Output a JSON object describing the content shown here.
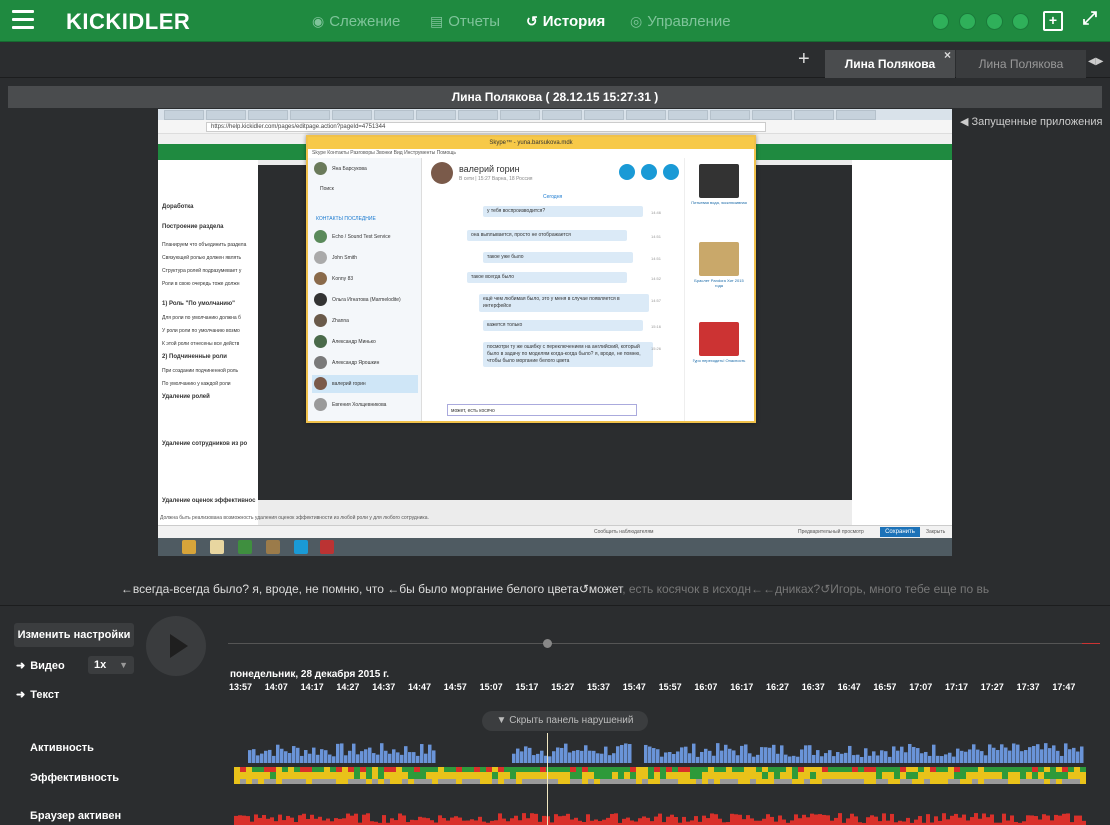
{
  "topbar": {
    "logo": "KICKIDLER",
    "nav": [
      {
        "label": "Слежение",
        "icon": "eye-icon",
        "glyph": "◉",
        "active": false
      },
      {
        "label": "Отчеты",
        "icon": "report-icon",
        "glyph": "▤",
        "active": false
      },
      {
        "label": "История",
        "icon": "history-icon",
        "glyph": "↺",
        "active": true
      },
      {
        "label": "Управление",
        "icon": "manage-icon",
        "glyph": "◎",
        "active": false
      }
    ],
    "colors": {
      "green": "#1f8a40",
      "active_dot": "#2fb05a"
    }
  },
  "tabs": {
    "items": [
      {
        "label": "Лина Полякова",
        "active": true
      },
      {
        "label": "Лина Полякова",
        "active": false
      }
    ]
  },
  "screenshot": {
    "header": "Лина Полякова    ( 28.12.15 15:27:31 )",
    "apps_panel_label": "Запущенные приложения",
    "address": "https://help.kickidler.com/pages/editpage.action?pageId=4751344",
    "doc_lines": [
      {
        "text": "Доработка",
        "bold": true
      },
      {
        "text": "Построение раздела",
        "bold": true
      },
      {
        "text": "Планируем что объединить раздела",
        "bold": false
      },
      {
        "text": "Связующей ролью должен являть",
        "bold": false
      },
      {
        "text": "Структура ролей подразумевает у",
        "bold": false
      },
      {
        "text": "Роли в свою очередь тоже должн",
        "bold": false
      },
      {
        "text": "1) Роль \"По умолчанию\"",
        "bold": true
      },
      {
        "text": "Для роли по умолчанию должна б",
        "bold": false
      },
      {
        "text": "У роли роли по умолчанию возмо",
        "bold": false
      },
      {
        "text": "К этой роли отнесены все действ",
        "bold": false
      },
      {
        "text": "2) Подчиненные роли",
        "bold": true
      },
      {
        "text": "При создании подчиненной роль",
        "bold": false
      },
      {
        "text": "По умолчанию у каждой роли",
        "bold": false
      },
      {
        "text": "Удаление ролей",
        "bold": true
      },
      {
        "text": "Удаление сотрудников из ро",
        "bold": true
      },
      {
        "text": "Удаление оценок эффективнос",
        "bold": true
      }
    ],
    "bottom_note": "Должна быть реализована возможность удаления оценок эффективности из любой роли у для любого сотрудника.",
    "save_label": "Сохранить",
    "cancel_label": "Закрыть",
    "preview_label": "Предварительный просмотр",
    "notify_label": "Сообщить наблюдателям",
    "skype": {
      "title": "Skype™ - yuna.barsukova.mdk",
      "menu": "Skype  Контакты  Разговоры  Звонки  Вид  Инструменты  Помощь",
      "self_name": "Яна Барсукова",
      "search": "Поиск",
      "contacts_header": "КОНТАКТЫ  ПОСЛЕДНИЕ",
      "contacts": [
        "Echo / Sound Test Service",
        "John Smith",
        "Konny 83",
        "Ольга Игнатова (Marmelodite)",
        "Zhanna",
        "Александр Минько",
        "Александр Ярошкин",
        "валерий горин",
        "Евгения Холщевникова"
      ],
      "chat_name": "валерий горин",
      "chat_status": "В сети | 15:27 Варна, 18 Россия",
      "today": "Сегодня",
      "messages": [
        {
          "text": "у тебя воспроизводится?",
          "time": "14:46"
        },
        {
          "text": "она выплывается, просто не отображается",
          "time": "14:51"
        },
        {
          "text": "такое уже было",
          "time": "14:51"
        },
        {
          "text": "такое всегда было",
          "time": "14:52"
        },
        {
          "text": "ещё чем любимая было, это у меня в случае появляется в интерфейсе",
          "time": "14:57"
        },
        {
          "text": "кажется только",
          "time": "15:16"
        },
        {
          "text": "посмотри ту же ошибку с переключением на английский, который было в задачу по моделям когда-когда было? я, вроде, не помню, чтобы было моргание белого цвета",
          "time": "15:26"
        }
      ],
      "input_value": "может, есть косячо",
      "ads": [
        "Питьевая вода, эксклюзивная",
        "Браслет Pandora Хит 2015 года",
        "Гуро переходить! Опасность"
      ]
    }
  },
  "transcript": {
    "main": "←всегда-всегда было? я, вроде, не помню, что ←бы было моргание белого цвета↺может",
    "dim": ", есть косячок в исходн←←дниках?↺Игорь, много тебе еще по вь"
  },
  "player": {
    "settings_label": "Изменить настройки",
    "video_label": "Видео",
    "text_label": "Текст",
    "speed": "1x",
    "date": "понедельник, 28 декабря 2015 г.",
    "ticks": [
      "13:57",
      "14:07",
      "14:17",
      "14:27",
      "14:37",
      "14:47",
      "14:57",
      "15:07",
      "15:17",
      "15:27",
      "15:37",
      "15:47",
      "15:57",
      "16:07",
      "16:17",
      "16:27",
      "16:37",
      "16:47",
      "16:57",
      "17:07",
      "17:17",
      "17:27",
      "17:37",
      "17:47"
    ],
    "hide_label": "Скрыть панель нарушений",
    "rows": [
      "Активность",
      "Эффективность",
      "Браузер активен"
    ],
    "colors": {
      "activity": "#6a94d8",
      "green": "#2e9a3a",
      "yellow": "#e9c21a",
      "red": "#d9302a",
      "gray": "#9a9a9a"
    }
  }
}
